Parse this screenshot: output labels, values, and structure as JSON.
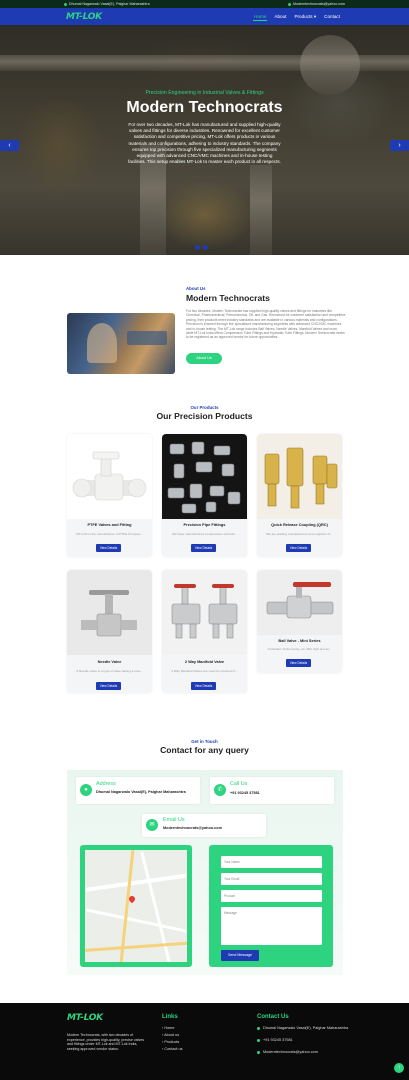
{
  "topbar": {
    "address": "Dhumal Nagarwalo Vasai(E), Palghar Maharashtra",
    "email": "Moderntechnocrats@yahoo.com"
  },
  "nav": {
    "logo": "MT-LOK",
    "links": [
      "Home",
      "About",
      "Products ▾",
      "Contact"
    ]
  },
  "hero": {
    "subtitle": "Precision Engineering in Industrial Valves & Fittings",
    "title": "Modern Technocrats",
    "text": "For over two decades, MT-Lok has manufactured and supplied high-quality valves and fittings for diverse industries. Renowned for excellent customer satisfaction and competitive pricing, MT-Lok offers products in various materials and configurations, adhering to industry standards. The company ensures top precision through five specialized manufacturing segments equipped with advanced CNC/VMC machines and in-house testing facilities. This setup enables MT-Lok to master each product in all respects.",
    "prev": "‹",
    "next": "›"
  },
  "about": {
    "eyebrow": "About Us",
    "title": "Modern Technocrats",
    "text": "For two decades, Modern Technocrats has supplied high-quality valves and fittings for industries like Chemical, Pharmaceutical, Petrochemical, Oil, and Gas. Renowned for customer satisfaction and competitive pricing, their products meet industry standards and are available in various materials and configurations. Precision is ensured through five specialized manufacturing segments with advanced CNC/VMC machines and in-house testing. The MT-Lok range includes Ball Valves, Needle Valves, Manifold Valves and more, while MT-Lok India offers Compression Tube Fittings and Hydraulic Tube Fittings. Modern Technocrats seeks to be registered as an approved vendor for future opportunities.",
    "button": "About Us"
  },
  "products": {
    "eyebrow": "Our Products",
    "title": "Our Precision Products",
    "button": "View Details",
    "items": [
      {
        "name": "PTFE Valves and Fitting",
        "desc": "MT-LOK is the manufacturer of PTFE Composi..."
      },
      {
        "name": "Precision Pipe Fittings",
        "desc": "We have manufactured compression and butt..."
      },
      {
        "name": "Quick Release Coupling (QRC)",
        "desc": "We are leading manufacturers and suppliers of..."
      },
      {
        "name": "Needle Valve",
        "desc": "A Needle valve is a type of valve having a sma..."
      },
      {
        "name": "2 Way Manifold Valve",
        "desc": "2 Way Manifold Valves are used for pressure fl..."
      },
      {
        "name": "Ball Valve - Mini Series",
        "desc": "At Modern Technocrats, we offer high-precisi..."
      }
    ]
  },
  "contact": {
    "eyebrow": "Get in Touch",
    "title": "Contact for any query",
    "address_label": "Address",
    "address": "Dhumal Nagarwalo Vasai(E), Palghar Maharashtra",
    "call_label": "Call Us",
    "phone": "+91 93245 37581",
    "email_label": "Email Us",
    "email": "Moderntechnocrats@yahoo.com",
    "form": {
      "name": "Your Name",
      "email": "Your Email",
      "product": "Product",
      "message": "Message",
      "submit": "Send Message"
    }
  },
  "footer": {
    "logo": "MT-LOK",
    "about": "Modern Technocrats, with two decades of experience, provides high-quality, precise valves and fittings under MT-Lok and MT-Lok India, seeking approved vendor status.",
    "links_head": "Links",
    "links": [
      "Home",
      "About us",
      "Products",
      "Contact us"
    ],
    "contact_head": "Contact Us",
    "address": "Dhumal Nagarwalo Vasai(E), Palghar Maharashtra",
    "phone": "+91 93245 37581",
    "email": "Moderntechnocrats@yahoo.com"
  },
  "colors": {
    "brand_blue": "#1f3bb3",
    "brand_green": "#2ed37f",
    "footer_bg": "#0a0a0a"
  }
}
